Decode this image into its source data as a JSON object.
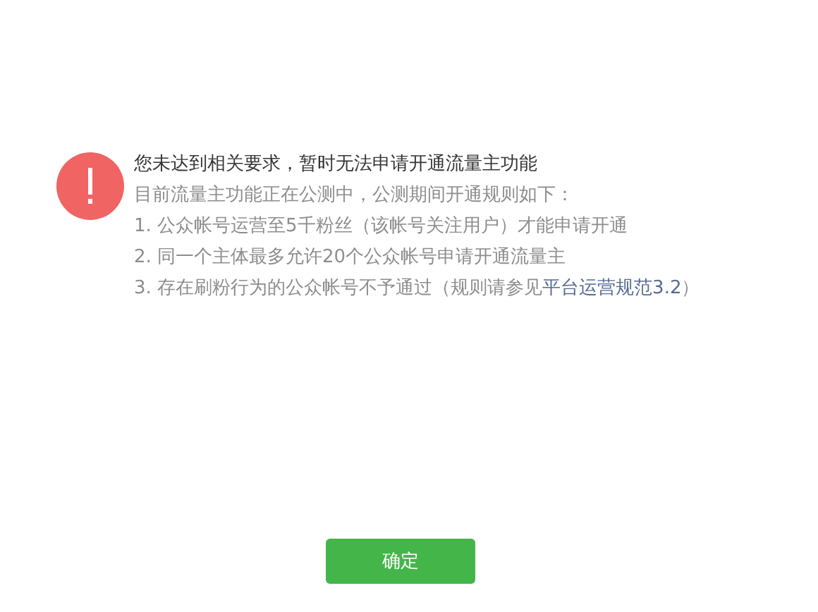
{
  "message": {
    "title": "您未达到相关要求，暂时无法申请开通流量主功能",
    "intro": "目前流量主功能正在公测中，公测期间开通规则如下：",
    "rules": [
      {
        "text": "1. 公众帐号运营至5千粉丝（该帐号关注用户）才能申请开通"
      },
      {
        "text": "2. 同一个主体最多允许20个公众帐号申请开通流量主"
      },
      {
        "text": "3. 存在刷粉行为的公众帐号不予通过（规则请参见",
        "link": "平台运营规范3.2",
        "suffix": "）"
      }
    ]
  },
  "buttons": [
    {
      "label": "确定"
    }
  ]
}
